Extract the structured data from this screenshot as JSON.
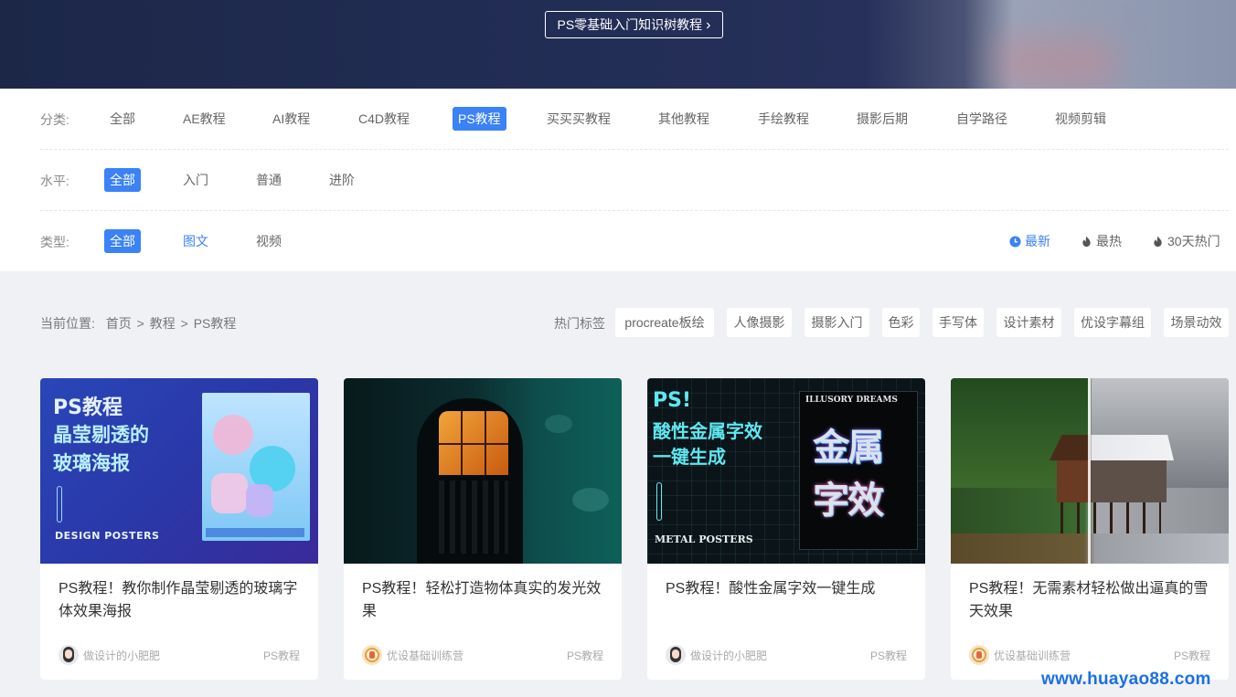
{
  "banner": {
    "button_label": "PS零基础入门知识树教程"
  },
  "filters": {
    "category": {
      "label": "分类:",
      "options": [
        "全部",
        "AE教程",
        "AI教程",
        "C4D教程",
        "PS教程",
        "买买买教程",
        "其他教程",
        "手绘教程",
        "摄影后期",
        "自学路径",
        "视频剪辑"
      ],
      "selected": "PS教程"
    },
    "level": {
      "label": "水平:",
      "options": [
        "全部",
        "入门",
        "普通",
        "进阶"
      ],
      "selected": "全部"
    },
    "type": {
      "label": "类型:",
      "options": [
        "全部",
        "图文",
        "视频"
      ],
      "selected": "全部"
    },
    "sort": [
      {
        "label": "最新",
        "icon": "clock-icon",
        "active": true
      },
      {
        "label": "最热",
        "icon": "flame-icon",
        "active": false
      },
      {
        "label": "30天热门",
        "icon": "flame-icon",
        "active": false
      }
    ]
  },
  "breadcrumb": {
    "prefix": "当前位置:",
    "items": [
      "首页",
      ">",
      "教程",
      ">",
      "PS教程"
    ]
  },
  "hot_tags": {
    "label": "热门标签",
    "tags": [
      "procreate板绘",
      "人像摄影",
      "摄影入门",
      "色彩",
      "手写体",
      "设计素材",
      "优设字幕组",
      "场景动效"
    ]
  },
  "cards": [
    {
      "title": "PS教程！教你制作晶莹剔透的玻璃字体效果海报",
      "author": "做设计的小肥肥",
      "category": "PS教程",
      "avatar_icon": "avatar-girl-icon",
      "thumb_text": [
        "PS教程",
        "晶莹剔透的",
        "玻璃海报",
        "DESIGN POSTERS"
      ],
      "thumb_colors": [
        "#1f3aa8",
        "#3a2aa0"
      ]
    },
    {
      "title": "PS教程！轻松打造物体真实的发光效果",
      "author": "优设基础训练营",
      "category": "PS教程",
      "avatar_icon": "avatar-badge-icon",
      "thumb_text": [],
      "thumb_colors": [
        "#0b2a2c",
        "#0f5a55"
      ]
    },
    {
      "title": "PS教程！酸性金属字效一键生成",
      "author": "做设计的小肥肥",
      "category": "PS教程",
      "avatar_icon": "avatar-girl-icon",
      "thumb_text": [
        "PS!",
        "酸性金属字效",
        "一键生成",
        "METAL POSTERS",
        "ILLUSORY DREAMS",
        "金属",
        "字效"
      ],
      "thumb_colors": [
        "#0a1418",
        "#1a2430"
      ]
    },
    {
      "title": "PS教程！无需素材轻松做出逼真的雪天效果",
      "author": "优设基础训练营",
      "category": "PS教程",
      "avatar_icon": "avatar-badge-icon",
      "thumb_text": [],
      "thumb_colors": [
        "#2f5a2a",
        "#a8aab0"
      ]
    }
  ],
  "watermark": "www.huayao88.com"
}
